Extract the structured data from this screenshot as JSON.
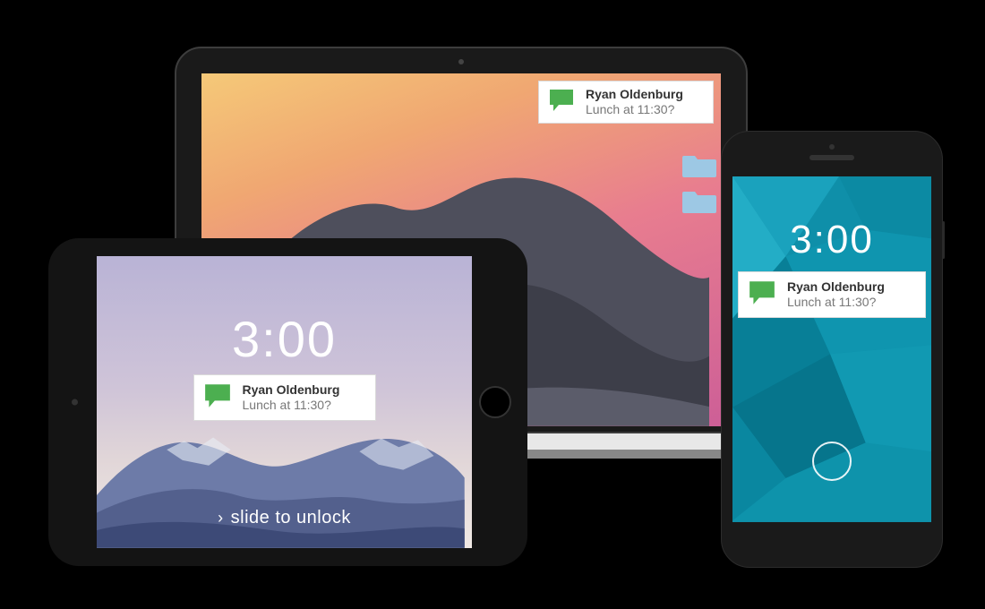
{
  "notification": {
    "sender": "Ryan Oldenburg",
    "message": "Lunch at 11:30?",
    "icon": "chat-bubble-icon",
    "icon_color": "#4CAF50"
  },
  "tablet": {
    "time": "3:00",
    "unlock_hint": "slide to unlock"
  },
  "phone": {
    "time": "3:00"
  },
  "laptop": {
    "folders": 2
  }
}
